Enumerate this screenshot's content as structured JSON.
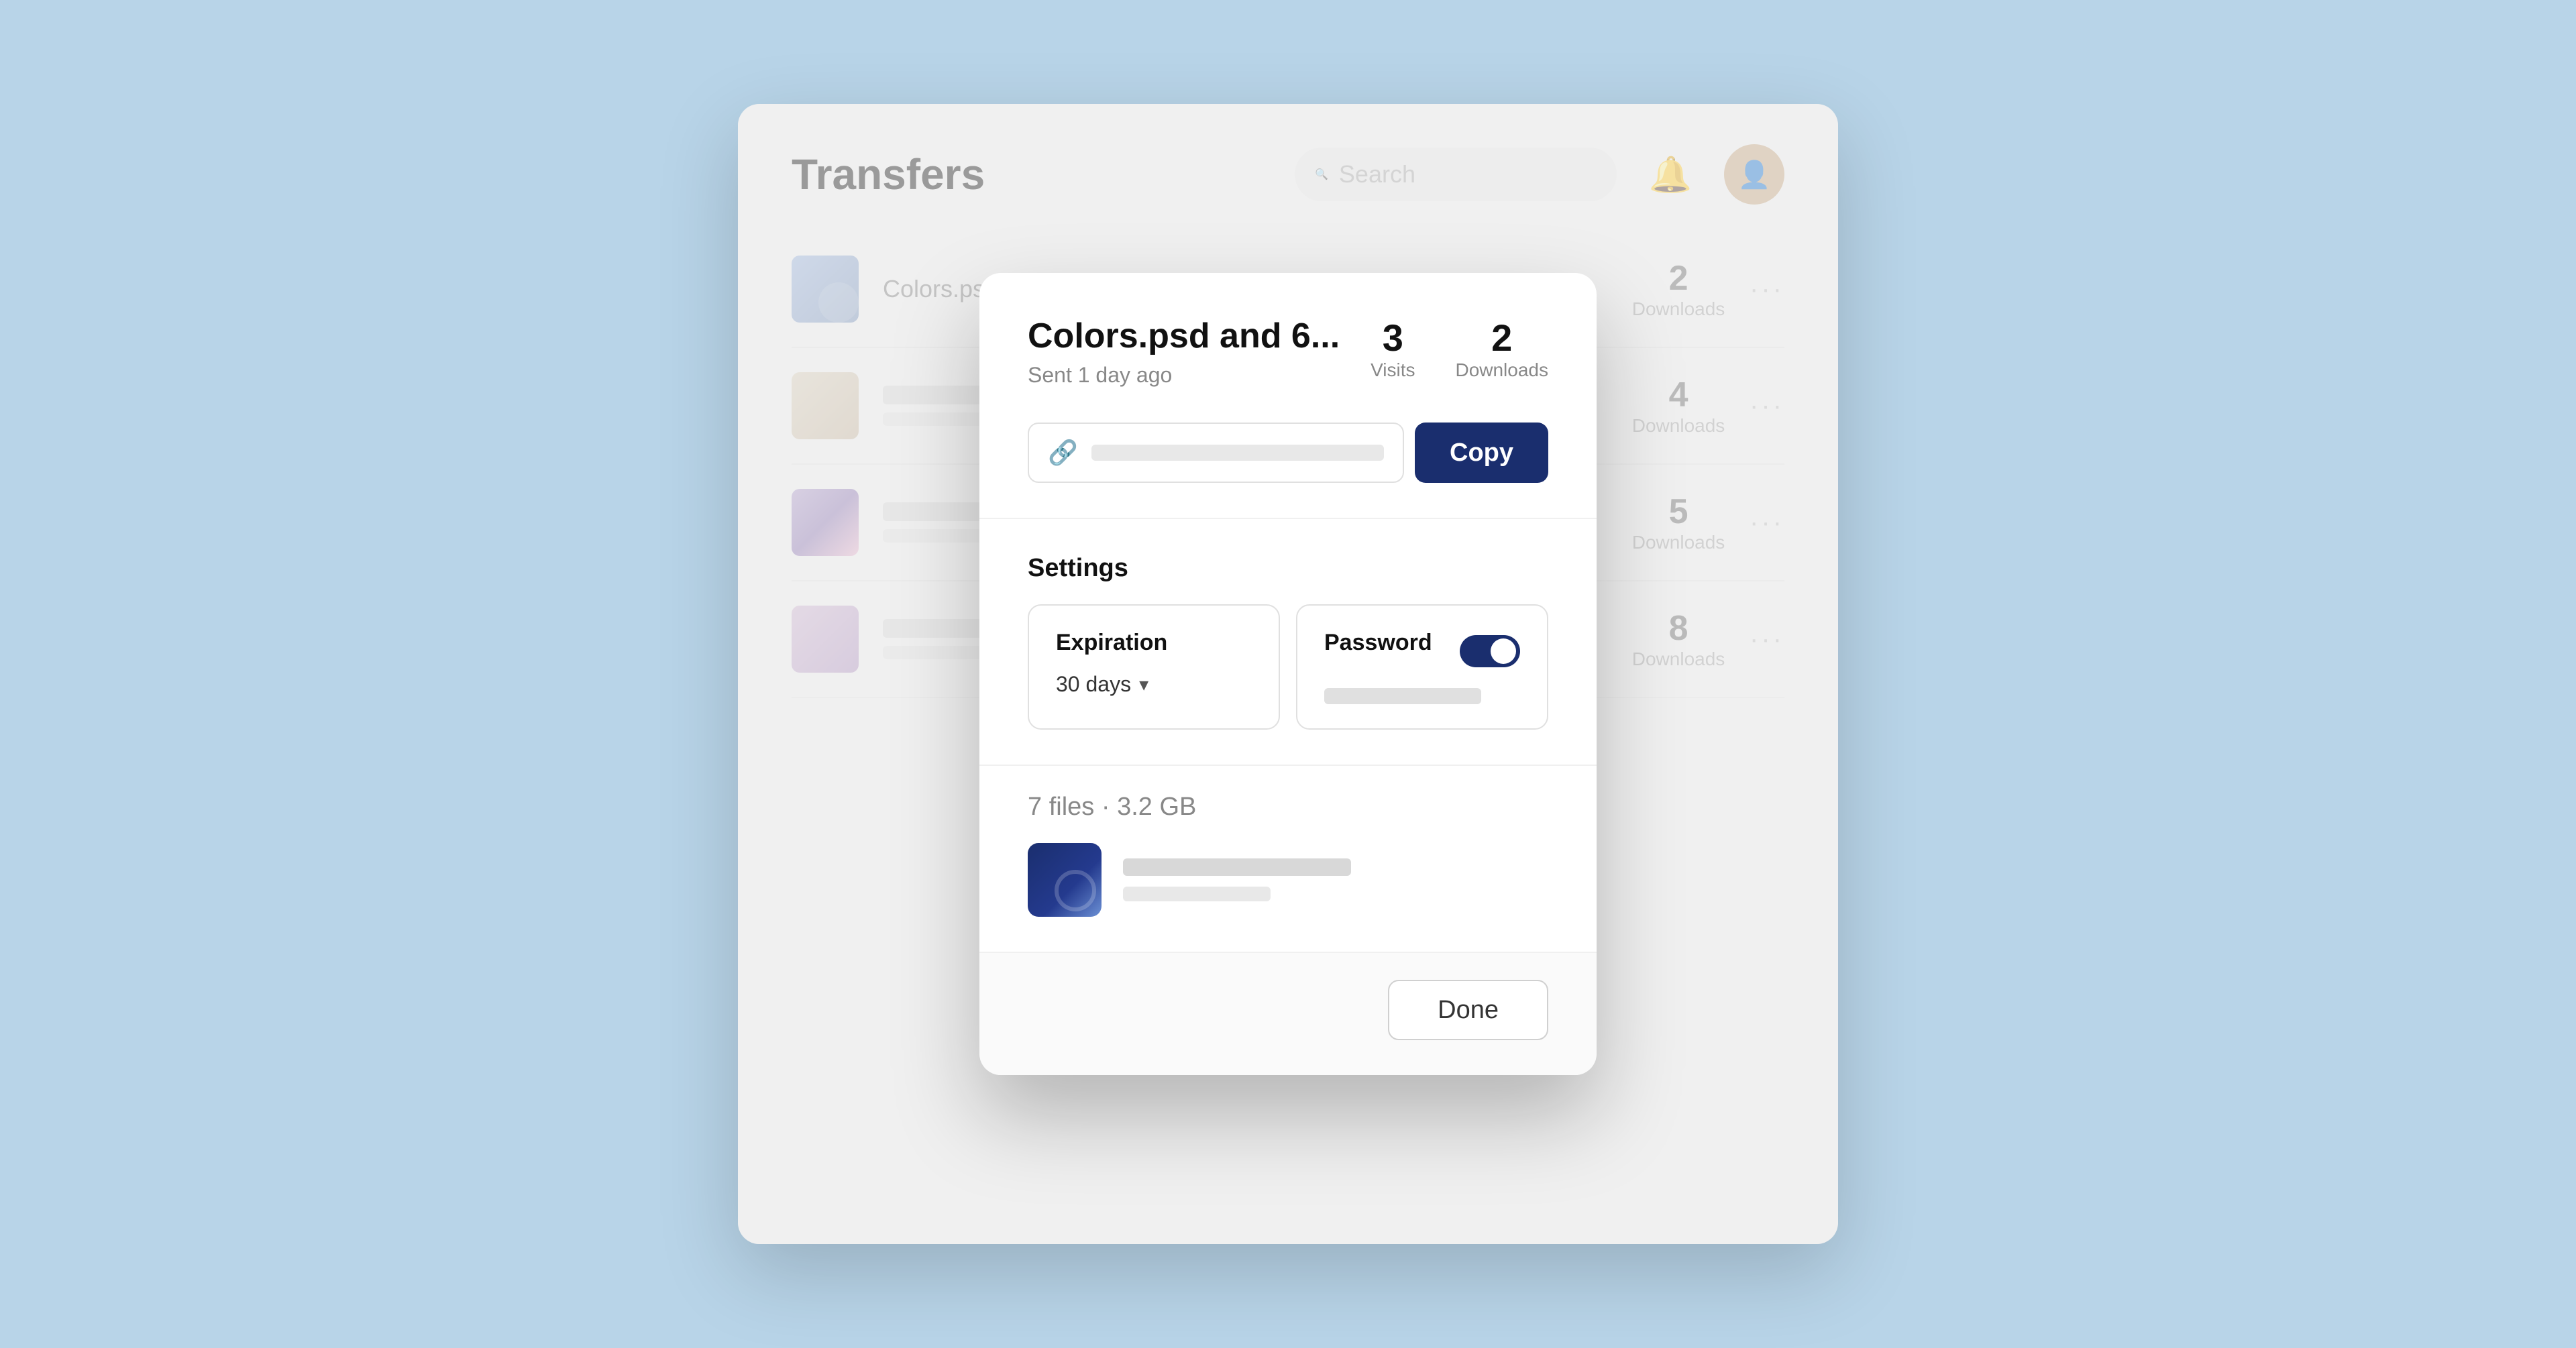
{
  "app": {
    "title": "Transfers",
    "search_placeholder": "Search"
  },
  "modal": {
    "title": "Colors.psd and 6...",
    "sent_ago": "Sent 1 day ago",
    "visits_count": "3",
    "visits_label": "Visits",
    "downloads_count": "2",
    "downloads_label": "Downloads",
    "copy_button": "Copy",
    "settings_title": "Settings",
    "expiration_label": "Expiration",
    "expiration_value": "30 days",
    "password_label": "Password",
    "files_count": "7 files",
    "files_size": "3.2 GB",
    "done_button": "Done"
  },
  "transfers": [
    {
      "name": "Colors.ps",
      "downloads": "2",
      "downloads_label": "Downloads"
    },
    {
      "name": "",
      "downloads": "4",
      "downloads_label": "Downloads"
    },
    {
      "name": "",
      "downloads": "5",
      "downloads_label": "Downloads"
    },
    {
      "name": "",
      "downloads": "8",
      "downloads_label": "Downloads"
    }
  ]
}
